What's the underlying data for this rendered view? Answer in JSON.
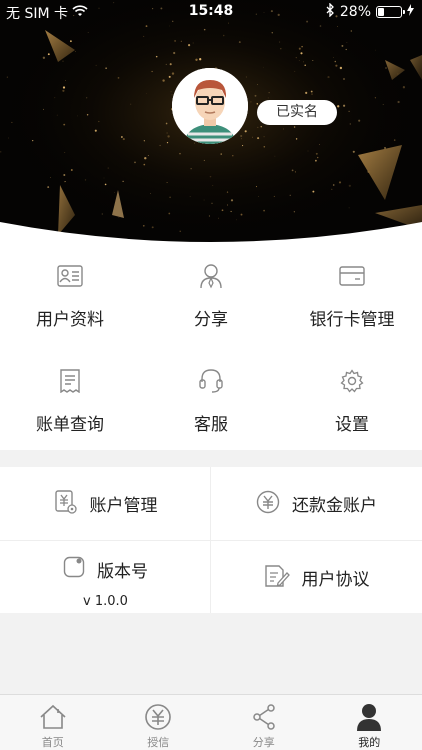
{
  "status_bar": {
    "carrier": "无 SIM 卡",
    "time": "15:48",
    "battery_text": "28%",
    "battery_level": 0.28
  },
  "profile": {
    "verify_badge": "已实名"
  },
  "grid_menu": [
    {
      "label": "用户资料",
      "icon": "id-card-icon"
    },
    {
      "label": "分享",
      "icon": "person-icon"
    },
    {
      "label": "银行卡管理",
      "icon": "bank-card-icon"
    },
    {
      "label": "账单查询",
      "icon": "receipt-icon"
    },
    {
      "label": "客服",
      "icon": "headset-icon"
    },
    {
      "label": "设置",
      "icon": "gear-icon"
    }
  ],
  "list_menu": {
    "account": {
      "label": "账户管理",
      "icon": "yen-document-icon"
    },
    "repayment": {
      "label": "还款金账户",
      "icon": "yen-circle-icon"
    },
    "version": {
      "label": "版本号",
      "value": "v 1.0.0",
      "icon": "rounded-square-icon"
    },
    "agreement": {
      "label": "用户协议",
      "icon": "document-pen-icon"
    }
  },
  "tab_bar": [
    {
      "label": "首页",
      "icon": "home-icon"
    },
    {
      "label": "授信",
      "icon": "yen-circle-icon"
    },
    {
      "label": "分享",
      "icon": "share-icon"
    },
    {
      "label": "我的",
      "icon": "user-silhouette-icon",
      "active": true
    }
  ]
}
